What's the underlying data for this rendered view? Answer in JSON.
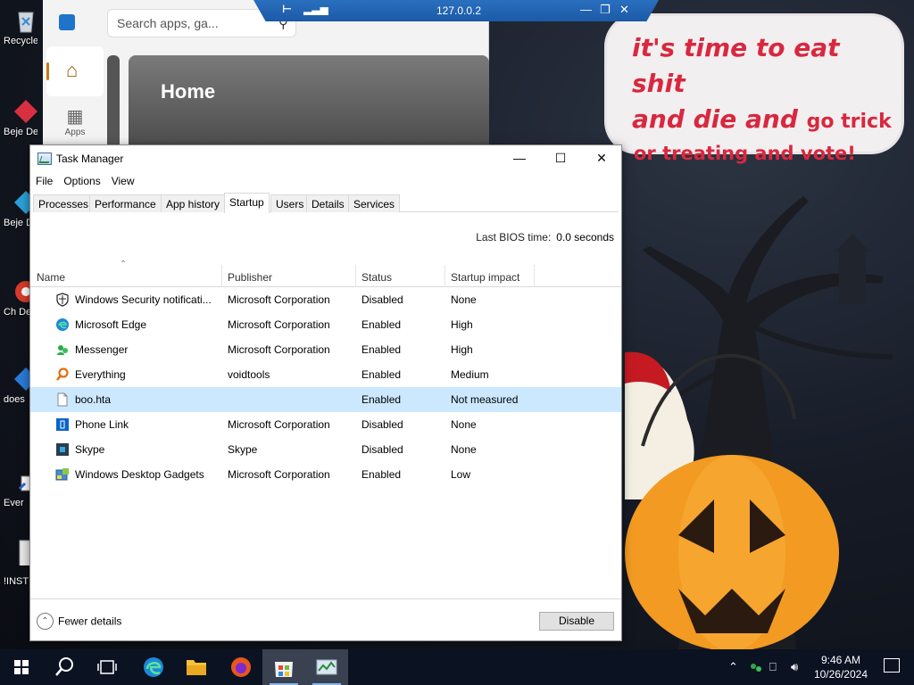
{
  "wallpaper": {
    "speech": {
      "line1": "it's time to eat shit",
      "line2a": "and die and",
      "line2b": "go trick",
      "line3": "or treating and vote!"
    }
  },
  "desktop_icons": [
    {
      "label": "Recycle",
      "icon": "recycle-bin-icon"
    },
    {
      "label": "Beje De",
      "icon": "bejeweled-icon"
    },
    {
      "label": "Beje De",
      "icon": "bejeweled-icon"
    },
    {
      "label": "Ch De",
      "icon": "chrome-icon"
    },
    {
      "label": "does",
      "icon": "shortcut-icon"
    },
    {
      "label": "Ever",
      "icon": "everything-icon"
    },
    {
      "label": "!INST",
      "icon": "file-icon"
    }
  ],
  "rdp": {
    "address": "127.0.0.2"
  },
  "store": {
    "search_placeholder": "Search apps, ga...",
    "nav_apps": "Apps",
    "banner_title": "Home"
  },
  "taskmgr": {
    "title": "Task Manager",
    "menu": [
      "File",
      "Options",
      "View"
    ],
    "tabs": [
      "Processes",
      "Performance",
      "App history",
      "Startup",
      "Users",
      "Details",
      "Services"
    ],
    "active_tab": "Startup",
    "bios_label": "Last BIOS time:",
    "bios_value": "0.0 seconds",
    "columns": {
      "name": "Name",
      "publisher": "Publisher",
      "status": "Status",
      "impact": "Startup impact"
    },
    "rows": [
      {
        "name": "Windows Security notificati...",
        "publisher": "Microsoft Corporation",
        "status": "Disabled",
        "impact": "None",
        "icon": "shield-icon"
      },
      {
        "name": "Microsoft Edge",
        "publisher": "Microsoft Corporation",
        "status": "Enabled",
        "impact": "High",
        "icon": "edge-icon"
      },
      {
        "name": "Messenger",
        "publisher": "Microsoft Corporation",
        "status": "Enabled",
        "impact": "High",
        "icon": "messenger-icon"
      },
      {
        "name": "Everything",
        "publisher": "voidtools",
        "status": "Enabled",
        "impact": "Medium",
        "icon": "everything-icon"
      },
      {
        "name": "boo.hta",
        "publisher": "",
        "status": "Enabled",
        "impact": "Not measured",
        "icon": "file-icon"
      },
      {
        "name": "Phone Link",
        "publisher": "Microsoft Corporation",
        "status": "Disabled",
        "impact": "None",
        "icon": "phone-link-icon"
      },
      {
        "name": "Skype",
        "publisher": "Skype",
        "status": "Disabled",
        "impact": "None",
        "icon": "skype-icon"
      },
      {
        "name": "Windows Desktop Gadgets",
        "publisher": "Microsoft Corporation",
        "status": "Enabled",
        "impact": "Low",
        "icon": "gadgets-icon"
      }
    ],
    "selected_row": 4,
    "fewer_details": "Fewer details",
    "disable_button": "Disable"
  },
  "taskbar": {
    "time": "9:46 AM",
    "date": "10/26/2024",
    "pinned": [
      "start-icon",
      "search-icon",
      "task-view-icon",
      "edge-icon",
      "file-explorer-icon",
      "firefox-icon",
      "store-icon",
      "task-manager-icon"
    ]
  },
  "colors": {
    "accent": "#0078d7",
    "selected_row": "#cce8ff",
    "speech_text": "#d8283f",
    "taskbar": "#0b1222"
  }
}
